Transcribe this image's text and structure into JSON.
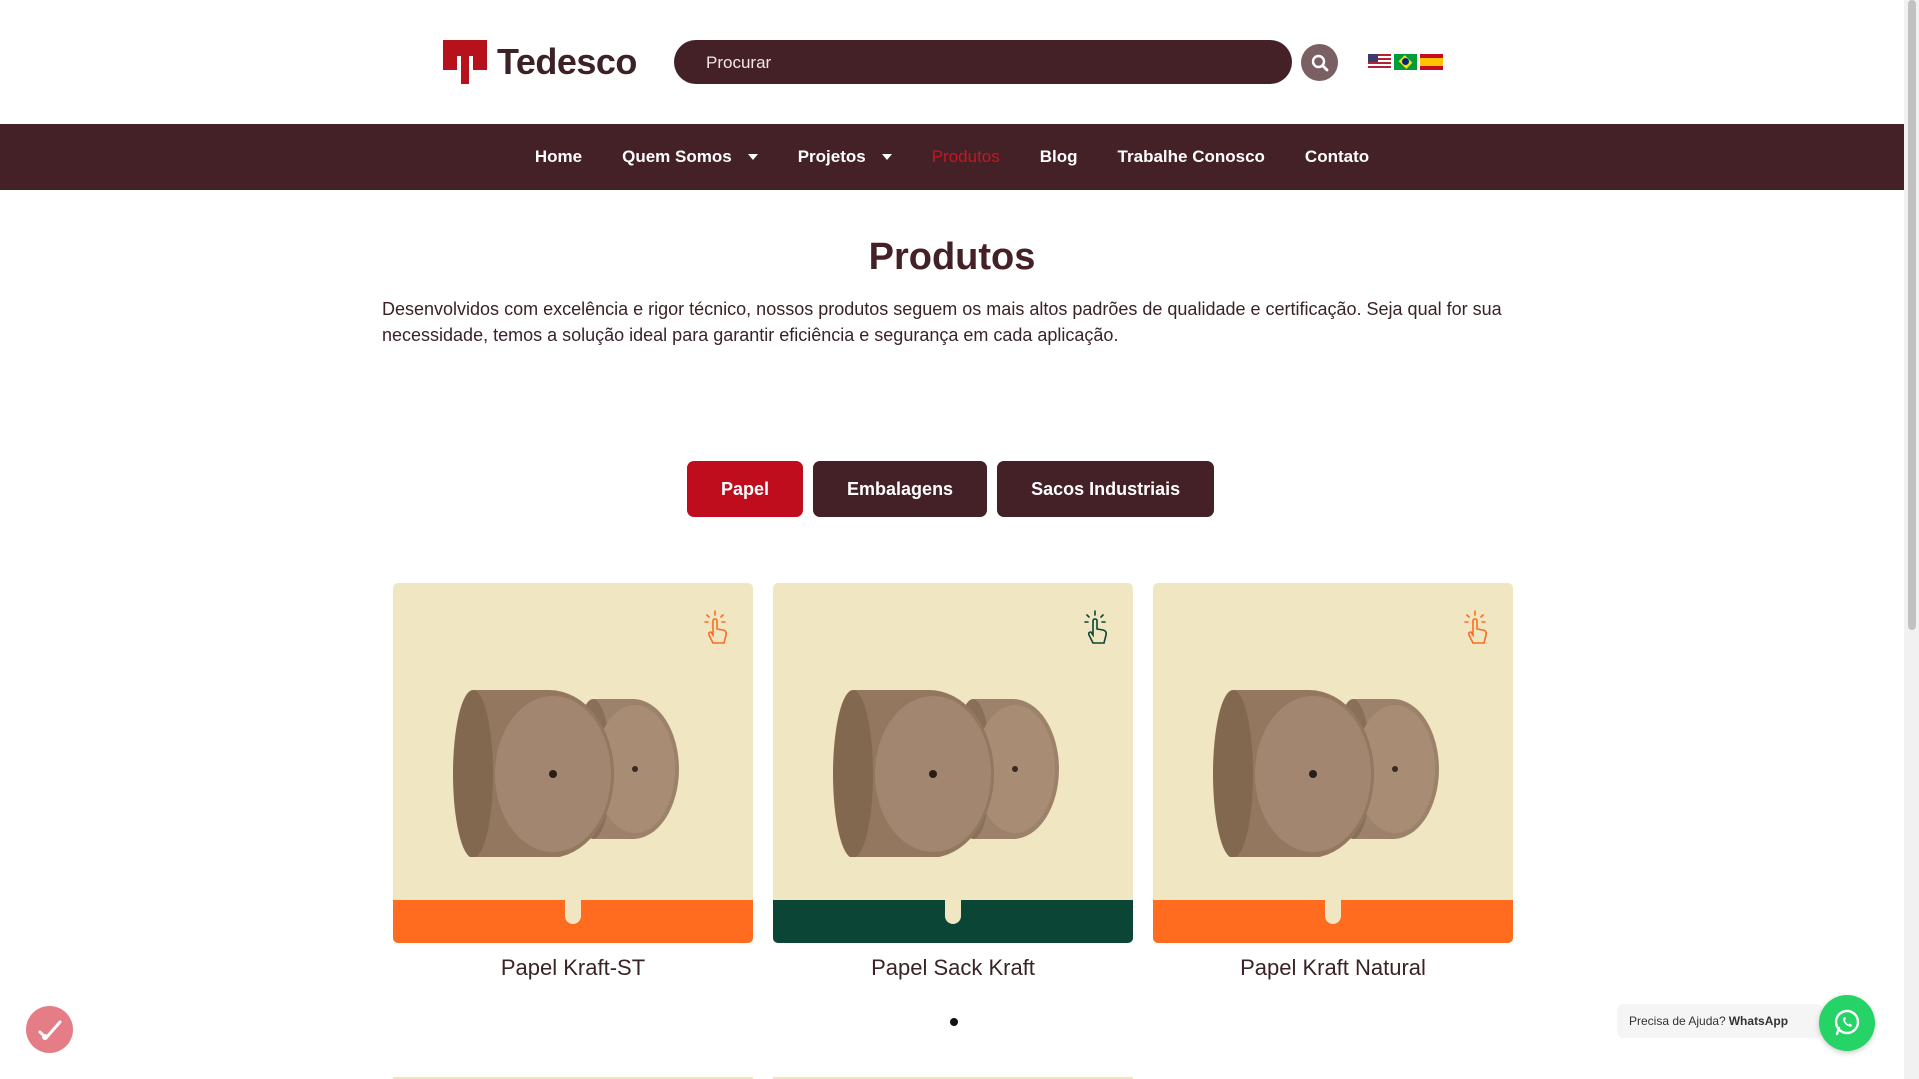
{
  "brand": {
    "name": "Tedesco",
    "color": "#b5121b"
  },
  "search": {
    "placeholder": "Procurar"
  },
  "languages": [
    "en-US",
    "pt-BR",
    "es"
  ],
  "nav": {
    "items": [
      {
        "label": "Home",
        "dropdown": false,
        "active": false
      },
      {
        "label": "Quem Somos",
        "dropdown": true,
        "active": false
      },
      {
        "label": "Projetos",
        "dropdown": true,
        "active": false
      },
      {
        "label": "Produtos",
        "dropdown": false,
        "active": true
      },
      {
        "label": "Blog",
        "dropdown": false,
        "active": false
      },
      {
        "label": "Trabalhe Conosco",
        "dropdown": false,
        "active": false
      },
      {
        "label": "Contato",
        "dropdown": false,
        "active": false
      }
    ]
  },
  "page": {
    "title": "Produtos",
    "description": "Desenvolvidos com excelência e rigor técnico, nossos produtos seguem os mais altos padrões de qualidade e certificação. Seja qual for sua necessidade, temos a solução ideal para garantir eficiência e segurança em cada aplicação."
  },
  "tabs": [
    {
      "label": "Papel",
      "active": true
    },
    {
      "label": "Embalagens",
      "active": false
    },
    {
      "label": "Sacos Industriais",
      "active": false
    }
  ],
  "products": [
    {
      "name": "Papel Kraft-ST",
      "band_color": "#ff6b1f",
      "icon": "tap-hand-icon"
    },
    {
      "name": "Papel Sack Kraft",
      "band_color": "#0b4535",
      "icon": "tap-hand-icon"
    },
    {
      "name": "Papel Kraft Natural",
      "band_color": "#ff6b1f",
      "icon": "tap-hand-icon"
    }
  ],
  "carousel": {
    "pages": 1,
    "current": 1
  },
  "whatsapp": {
    "prefix": "Precisa de Ajuda?",
    "label": "WhatsApp"
  },
  "colors": {
    "primary": "#442126",
    "accent": "#c00d1e"
  }
}
